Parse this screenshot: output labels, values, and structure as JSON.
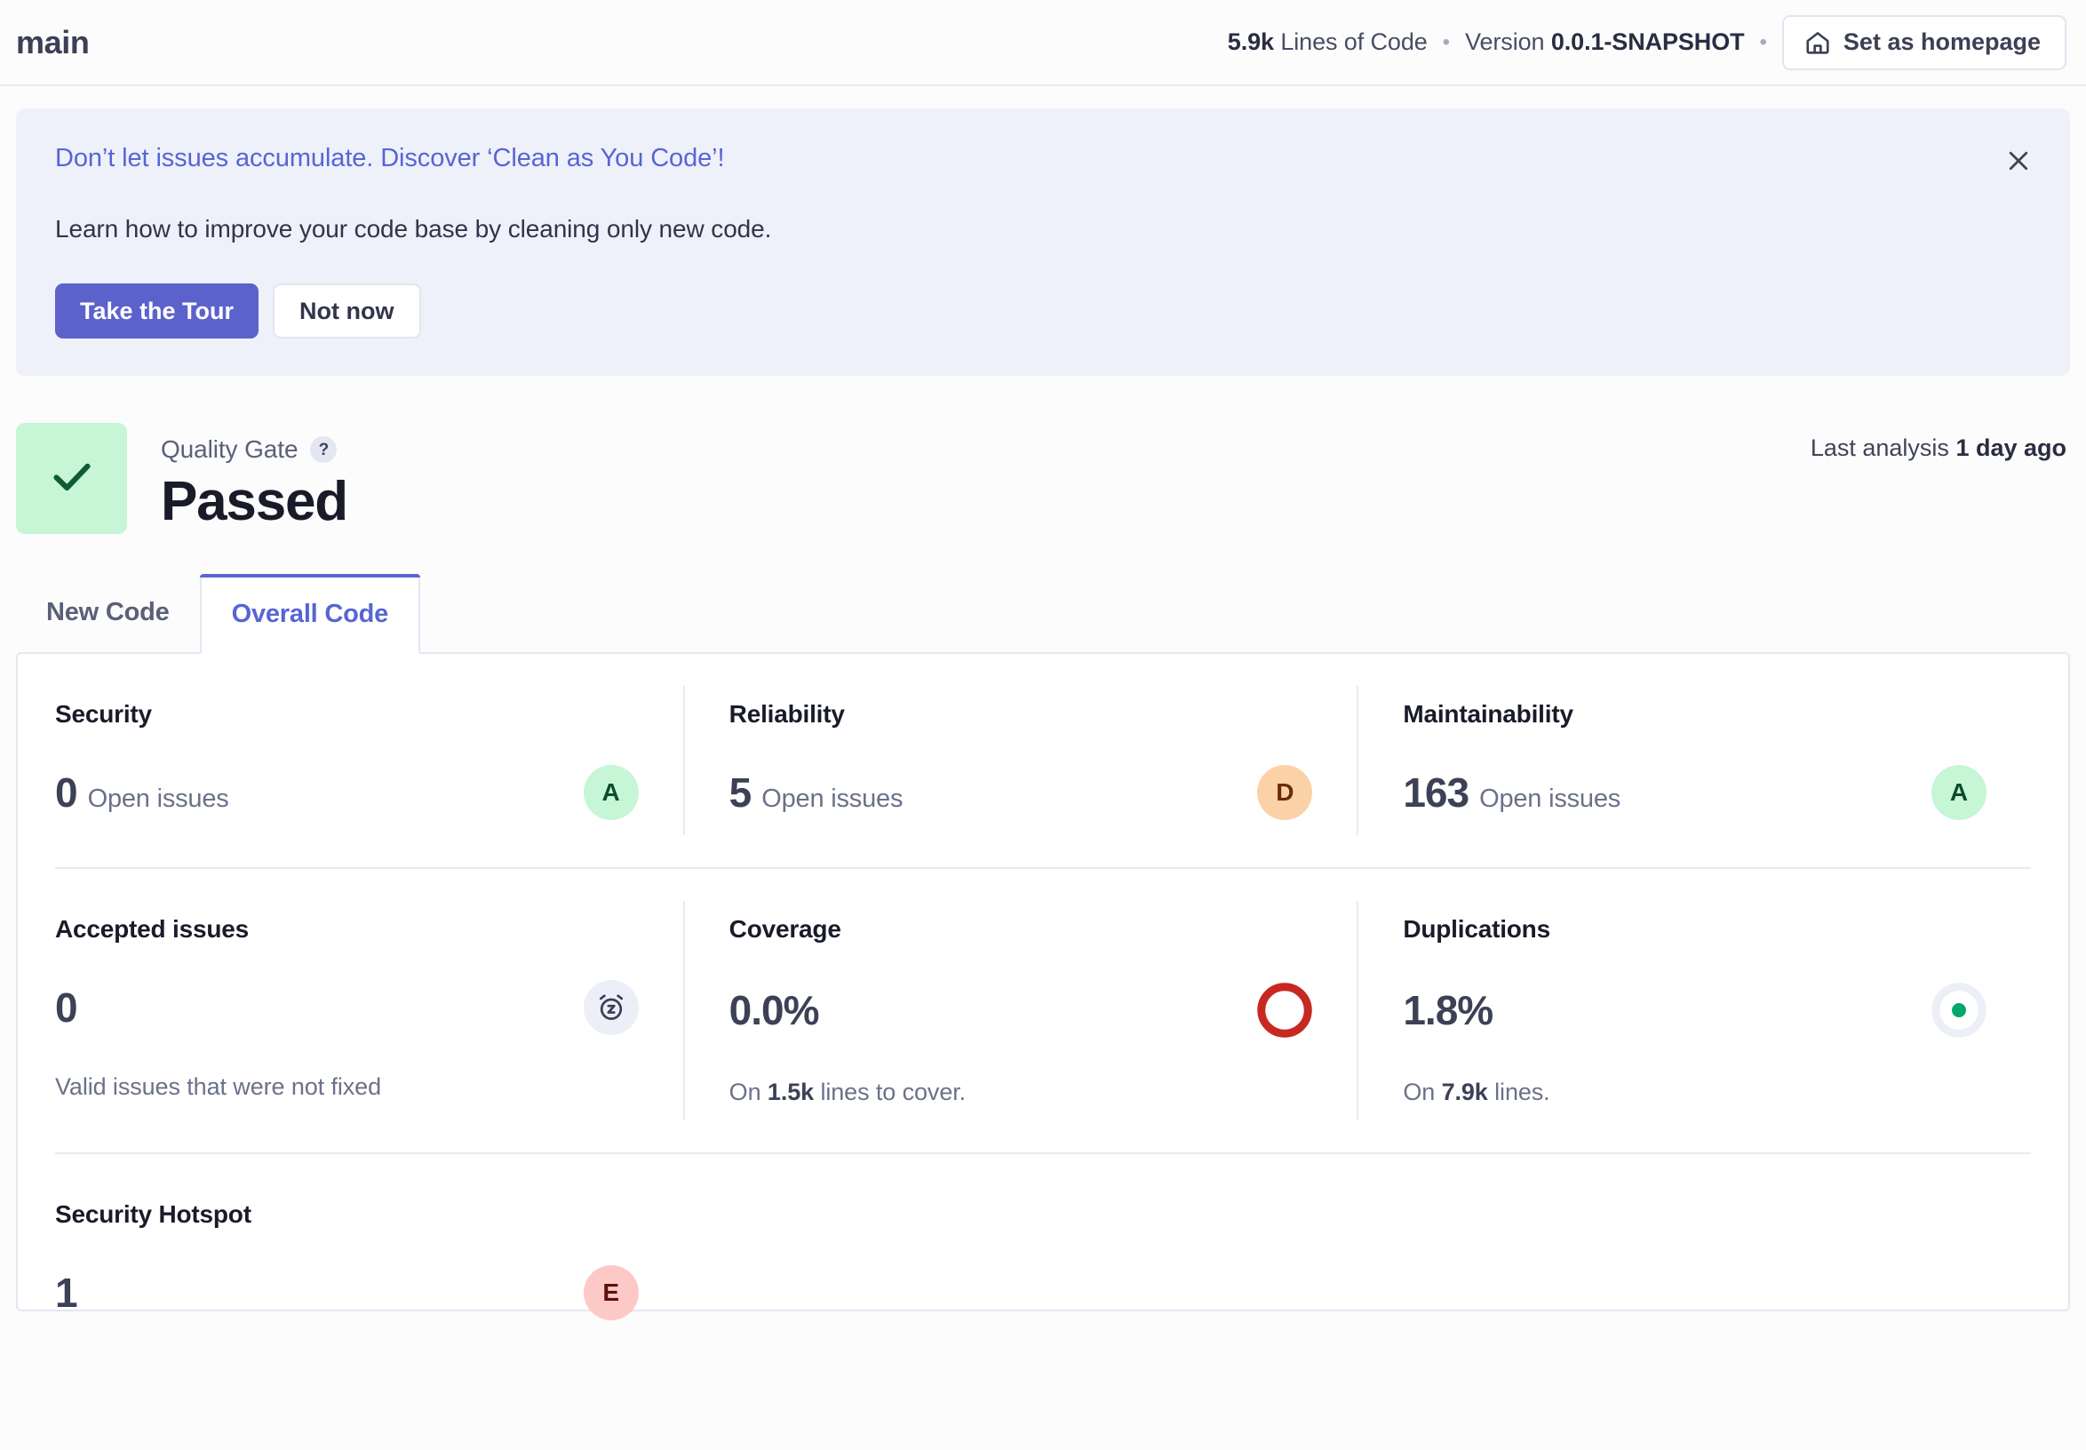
{
  "header": {
    "branch": "main",
    "lines_of_code_value": "5.9k",
    "lines_of_code_label": "Lines of Code",
    "separator": "•",
    "version_label": "Version",
    "version_value": "0.0.1-SNAPSHOT",
    "set_homepage_label": "Set as homepage"
  },
  "banner": {
    "title": "Don’t let issues accumulate. Discover ‘Clean as You Code’!",
    "description": "Learn how to improve your code base by cleaning only new code.",
    "primary_label": "Take the Tour",
    "secondary_label": "Not now"
  },
  "quality_gate": {
    "label": "Quality Gate",
    "help": "?",
    "status": "Passed",
    "last_analysis_label": "Last analysis",
    "last_analysis_value": "1 day ago"
  },
  "tabs": [
    {
      "label": "New Code",
      "active": false
    },
    {
      "label": "Overall Code",
      "active": true
    }
  ],
  "metrics": {
    "security": {
      "title": "Security",
      "value": "0",
      "unit": "Open issues",
      "rating": "A"
    },
    "reliability": {
      "title": "Reliability",
      "value": "5",
      "unit": "Open issues",
      "rating": "D"
    },
    "maintainability": {
      "title": "Maintainability",
      "value": "163",
      "unit": "Open issues",
      "rating": "A"
    },
    "accepted_issues": {
      "title": "Accepted issues",
      "value": "0",
      "sub_prefix": "Valid issues that were not fixed",
      "icon": "snooze-icon"
    },
    "coverage": {
      "title": "Coverage",
      "value": "0.0%",
      "sub_prefix": "On",
      "sub_value": "1.5k",
      "sub_suffix": "lines to cover.",
      "indicator": "empty-donut"
    },
    "duplications": {
      "title": "Duplications",
      "value": "1.8%",
      "sub_prefix": "On",
      "sub_value": "7.9k",
      "sub_suffix": "lines.",
      "indicator": "dot-donut"
    },
    "security_hotspot": {
      "title": "Security Hotspot",
      "value": "1",
      "rating": "E"
    }
  },
  "colors": {
    "accent": "#5765d4",
    "primary_button": "#5b62cc",
    "rating_a_bg": "#c6f6d5",
    "rating_d_bg": "#fbd2a7",
    "rating_e_bg": "#fcc9c6",
    "coverage_ring": "#c7281f",
    "duplications_dot": "#00a86b",
    "banner_bg": "#eef1fa"
  }
}
